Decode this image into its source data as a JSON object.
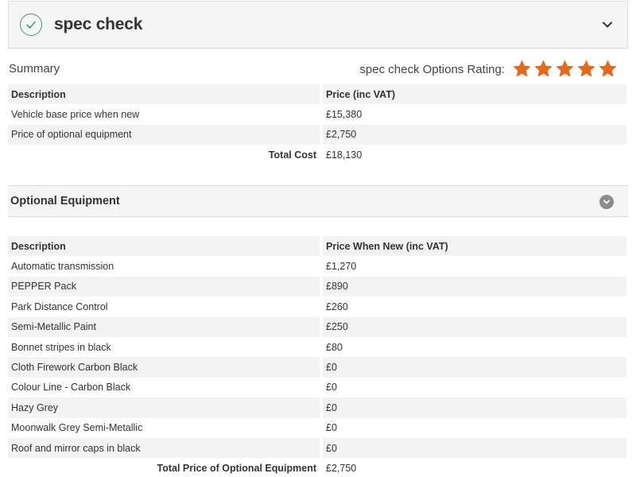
{
  "header": {
    "title": "spec check",
    "icons": {
      "status": "check-circle-icon",
      "toggle": "chevron-down-icon"
    }
  },
  "summary": {
    "label": "Summary",
    "rating_label": "spec check Options Rating:",
    "rating": {
      "value": 5,
      "max": 5,
      "star_color": "#e8681a"
    },
    "columns": [
      "Description",
      "Price (inc VAT)"
    ],
    "rows": [
      {
        "description": "Vehicle base price when new",
        "price": "£15,380"
      },
      {
        "description": "Price of optional equipment",
        "price": "£2,750"
      }
    ],
    "total": {
      "label": "Total Cost",
      "value": "£18,130"
    }
  },
  "optional": {
    "title": "Optional Equipment",
    "columns": [
      "Description",
      "Price When New (inc VAT)"
    ],
    "rows": [
      {
        "description": "Automatic transmission",
        "price": "£1,270"
      },
      {
        "description": "PEPPER Pack",
        "price": "£890"
      },
      {
        "description": "Park Distance Control",
        "price": "£260"
      },
      {
        "description": "Semi-Metallic Paint",
        "price": "£250"
      },
      {
        "description": "Bonnet stripes in black",
        "price": "£80"
      },
      {
        "description": "Cloth Firework Carbon Black",
        "price": "£0"
      },
      {
        "description": "Colour Line - Carbon Black",
        "price": "£0"
      },
      {
        "description": "Hazy Grey",
        "price": "£0"
      },
      {
        "description": "Moonwalk Grey Semi-Metallic",
        "price": "£0"
      },
      {
        "description": "Roof and mirror caps in black",
        "price": "£0"
      }
    ],
    "total": {
      "label": "Total Price of Optional Equipment",
      "value": "£2,750"
    }
  },
  "colors": {
    "accent_green": "#3fa063",
    "star_orange": "#e8681a",
    "row_shade": "#f3f3f3"
  }
}
